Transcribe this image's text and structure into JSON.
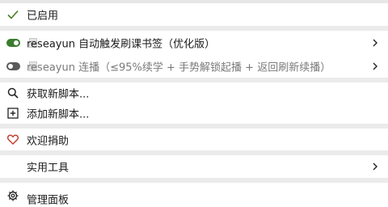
{
  "menu": {
    "enabled_label": "已启用",
    "scripts": [
      {
        "name": "reseayun 自动触发刷课书签（优化版）",
        "enabled": true
      },
      {
        "name": "reseayun 连播（≤95%续学 + 手势解锁起播 + 返回刷新续播）",
        "enabled": false
      }
    ],
    "get_new_scripts": "获取新脚本...",
    "add_new_script": "添加新脚本...",
    "donate": "欢迎捐助",
    "utilities": "实用工具",
    "dashboard": "管理面板"
  },
  "colors": {
    "check": "#4a7d23",
    "toggle_on": "#3a7d2e",
    "toggle_off": "#5a5a5a",
    "heart": "#c0392b"
  },
  "icons": {
    "enabled": "check-icon",
    "get_new": "search-icon",
    "add_new": "plus-square-icon",
    "donate": "heart-icon",
    "submenu": "chevron-right-icon",
    "dashboard": "gear-icon"
  }
}
